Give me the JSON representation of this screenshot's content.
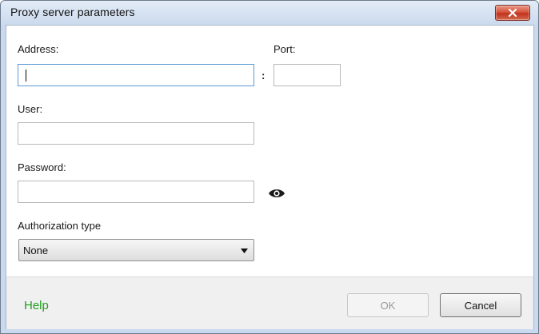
{
  "window": {
    "title": "Proxy server parameters"
  },
  "form": {
    "address_label": "Address:",
    "address_value": "",
    "port_label": "Port:",
    "port_value": "",
    "separator": ":",
    "user_label": "User:",
    "user_value": "",
    "password_label": "Password:",
    "password_value": "",
    "auth_label": "Authorization type",
    "auth_value": "None"
  },
  "footer": {
    "help_label": "Help",
    "ok_label": "OK",
    "ok_enabled": false,
    "cancel_label": "Cancel"
  },
  "icons": {
    "close": "close-icon",
    "password_toggle": "eye-icon",
    "dropdown": "chevron-down-icon"
  },
  "colors": {
    "help_link": "#1f9c1f",
    "focus_border": "#5c9ad6",
    "close_button": "#c0331d"
  }
}
